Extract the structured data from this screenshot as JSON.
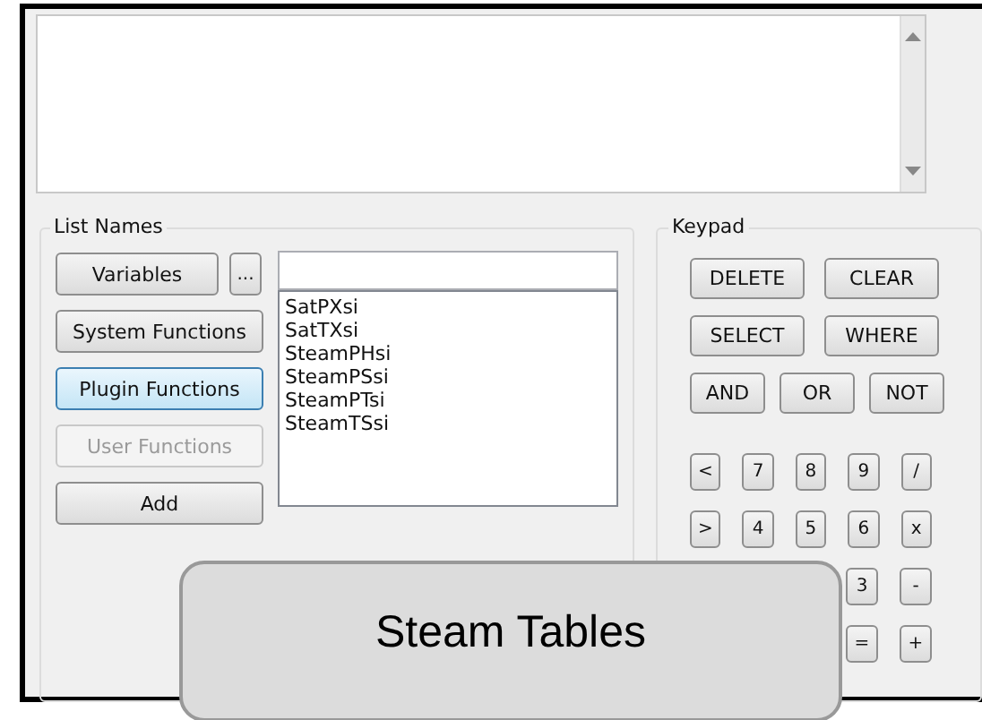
{
  "output_area": {
    "kind": "text_area"
  },
  "list_names": {
    "title": "List Names",
    "browse_button": "...",
    "buttons": [
      {
        "label": "Variables",
        "focused": false,
        "disabled": false
      },
      {
        "label": "System Functions",
        "focused": false,
        "disabled": false
      },
      {
        "label": "Plugin Functions",
        "focused": true,
        "disabled": false
      },
      {
        "label": "User Functions",
        "focused": false,
        "disabled": true
      },
      {
        "label": "Add",
        "focused": false,
        "disabled": false
      }
    ],
    "items": [
      "SatPXsi",
      "SatTXsi",
      "SteamPHsi",
      "SteamPSsi",
      "SteamPTsi",
      "SteamTSsi"
    ]
  },
  "keypad": {
    "title": "Keypad",
    "word_rows": [
      [
        "DELETE",
        "CLEAR"
      ],
      [
        "SELECT",
        "WHERE"
      ],
      [
        "AND",
        "OR",
        "NOT"
      ]
    ],
    "number_rows": [
      [
        "<",
        "7",
        "8",
        "9",
        "/"
      ],
      [
        ">",
        "4",
        "5",
        "6",
        "x"
      ],
      [
        "3",
        "-"
      ],
      [
        "=",
        "+"
      ]
    ]
  },
  "overlay": {
    "title": "Steam Tables"
  }
}
